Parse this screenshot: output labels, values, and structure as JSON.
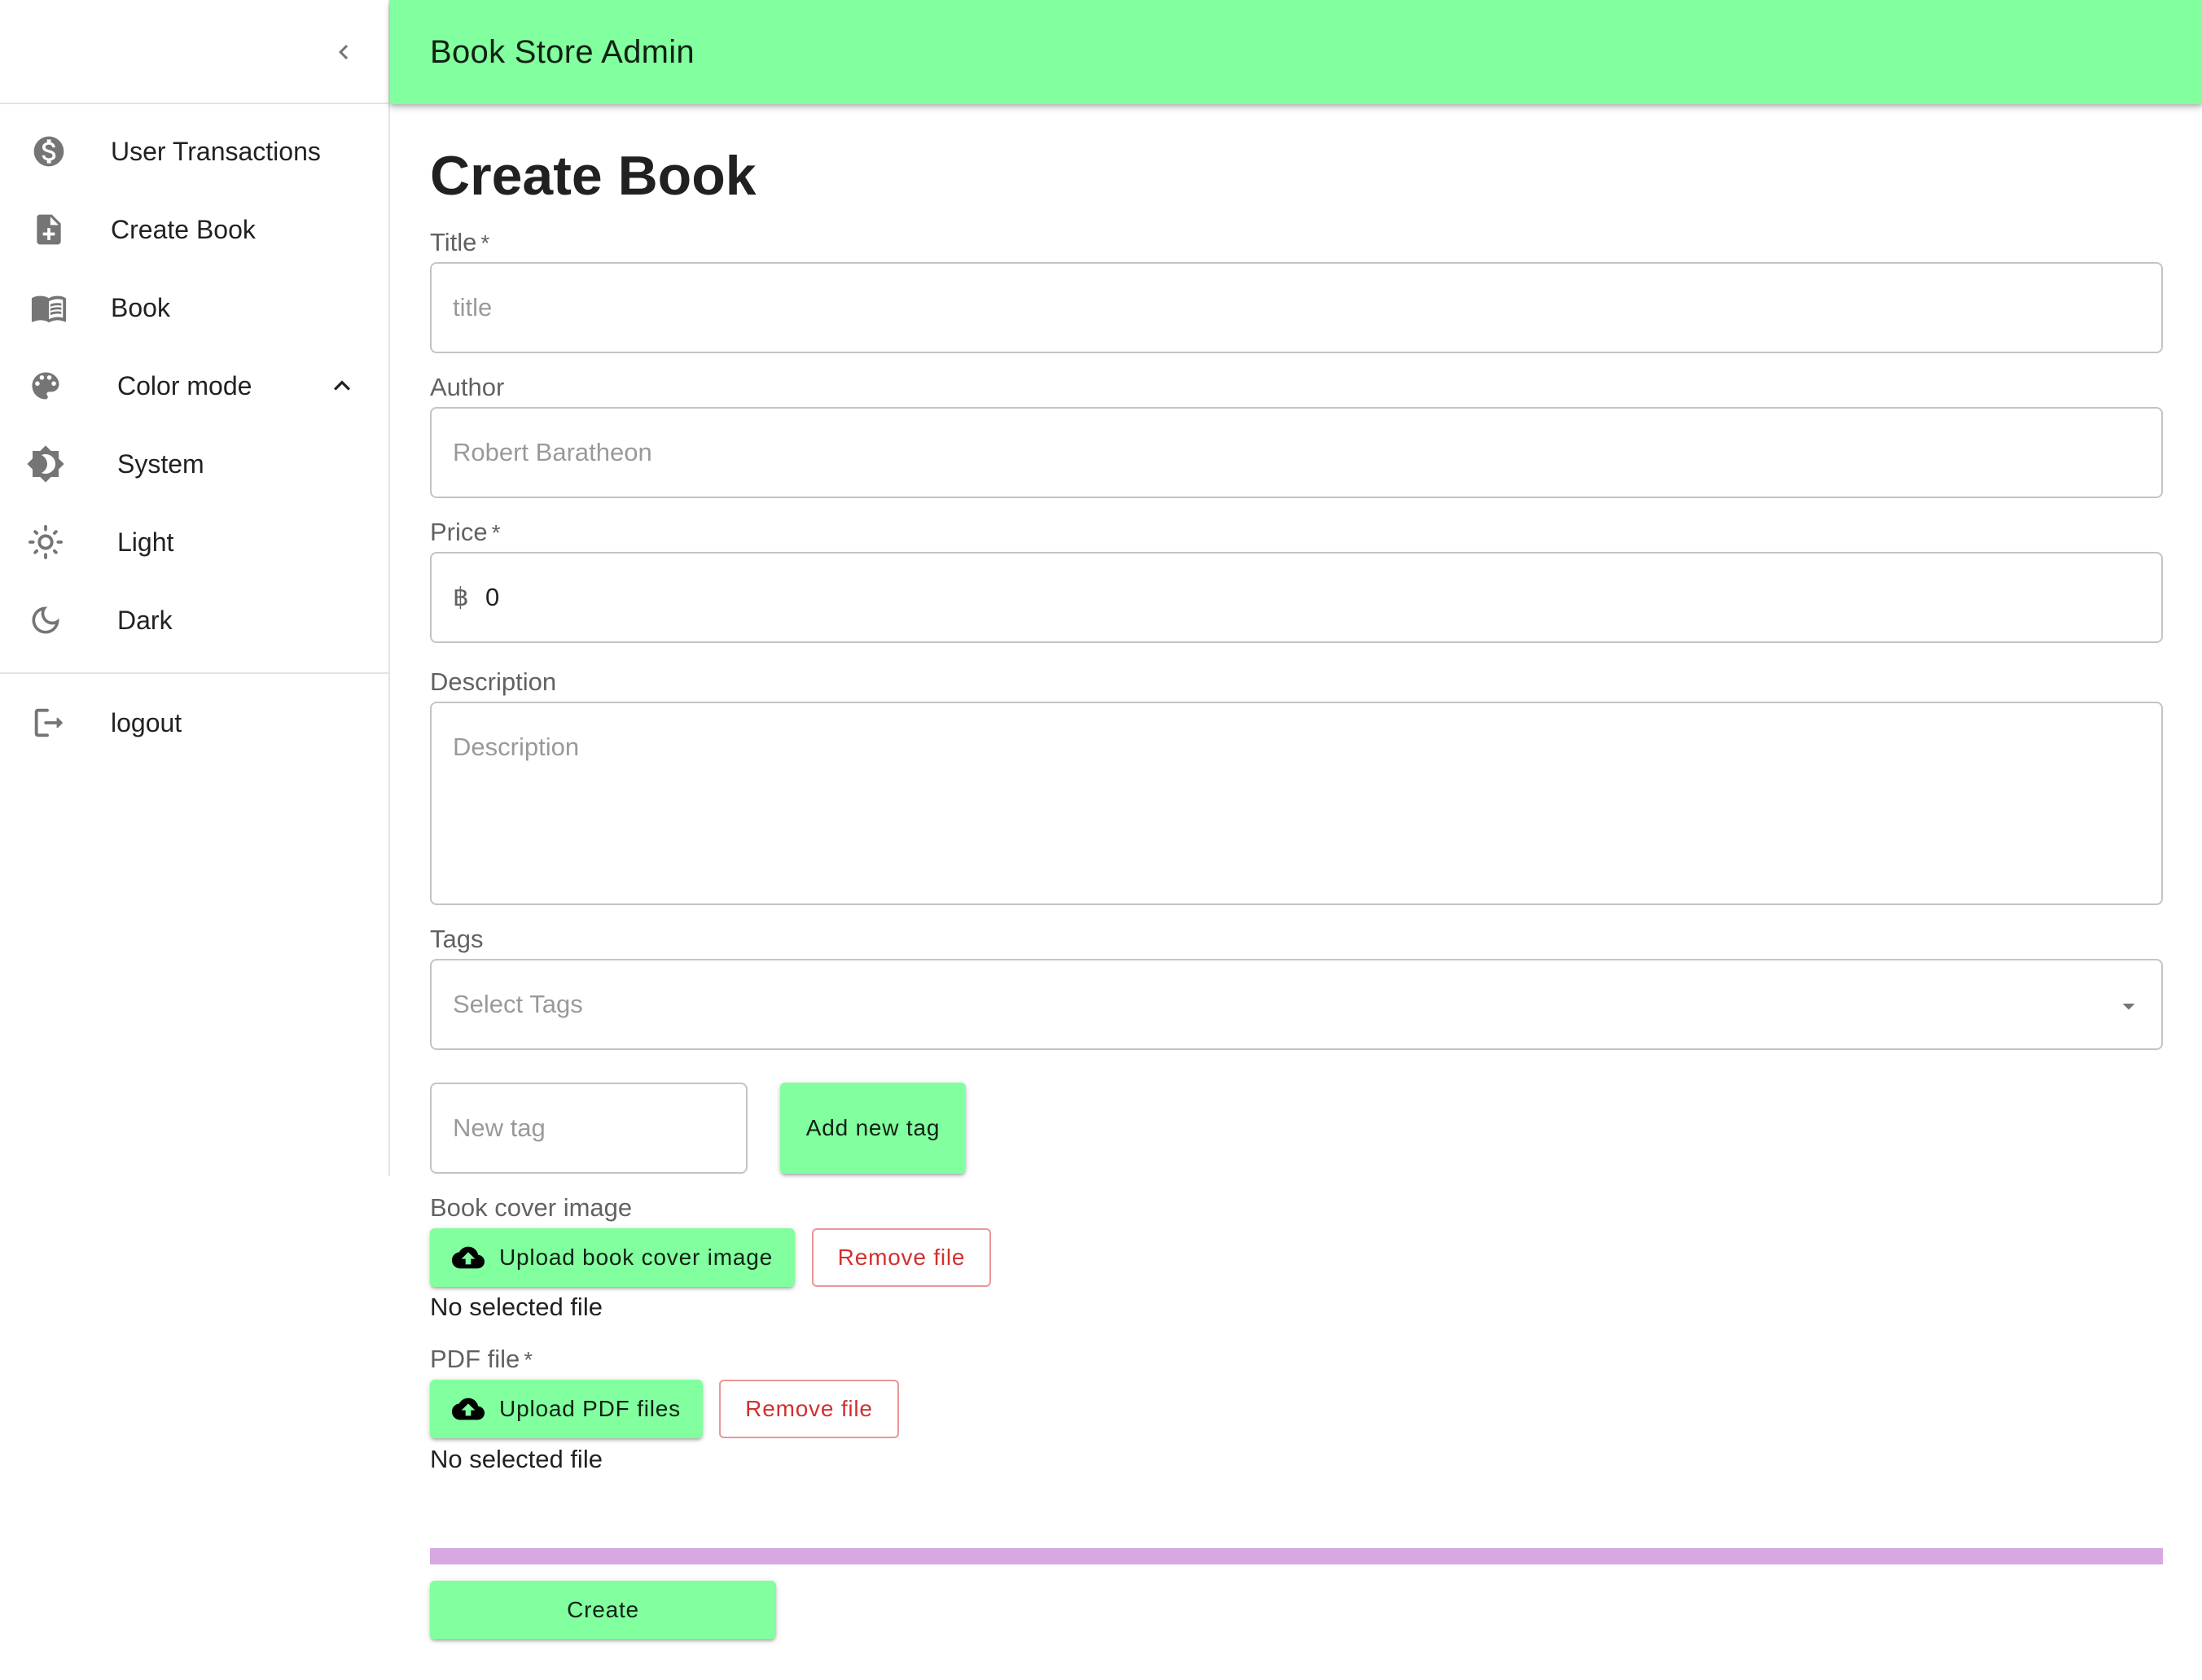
{
  "app": {
    "title": "Book Store Admin"
  },
  "sidebar": {
    "items": [
      {
        "label": "User Transactions",
        "icon": "dollar-circle-icon"
      },
      {
        "label": "Create Book",
        "icon": "note-add-icon"
      },
      {
        "label": "Book",
        "icon": "menu-book-icon"
      }
    ],
    "color_mode": {
      "label": "Color mode",
      "expanded": true,
      "options": [
        {
          "label": "System",
          "icon": "brightness-auto-icon"
        },
        {
          "label": "Light",
          "icon": "sun-icon"
        },
        {
          "label": "Dark",
          "icon": "moon-icon"
        }
      ]
    },
    "logout_label": "logout"
  },
  "form": {
    "page_title": "Create Book",
    "title": {
      "label": "Title",
      "required_mark": "*",
      "placeholder": "title",
      "value": ""
    },
    "author": {
      "label": "Author",
      "placeholder": "Robert Baratheon",
      "value": ""
    },
    "price": {
      "label": "Price",
      "required_mark": "*",
      "currency_symbol": "฿",
      "value": "0"
    },
    "description": {
      "label": "Description",
      "placeholder": "Description",
      "value": ""
    },
    "tags": {
      "label": "Tags",
      "placeholder": "Select Tags"
    },
    "new_tag": {
      "placeholder": "New tag",
      "button_label": "Add new tag"
    },
    "cover_image": {
      "label": "Book cover image",
      "upload_label": "Upload book cover image",
      "remove_label": "Remove file",
      "status": "No selected file"
    },
    "pdf_file": {
      "label": "PDF file",
      "required_mark": "*",
      "upload_label": "Upload PDF files",
      "remove_label": "Remove file",
      "status": "No selected file"
    },
    "progress": 0,
    "create_label": "Create"
  },
  "colors": {
    "accent_green": "#82ff9e",
    "danger_red": "#d32f2f",
    "progress_track": "#d7a9e0"
  }
}
